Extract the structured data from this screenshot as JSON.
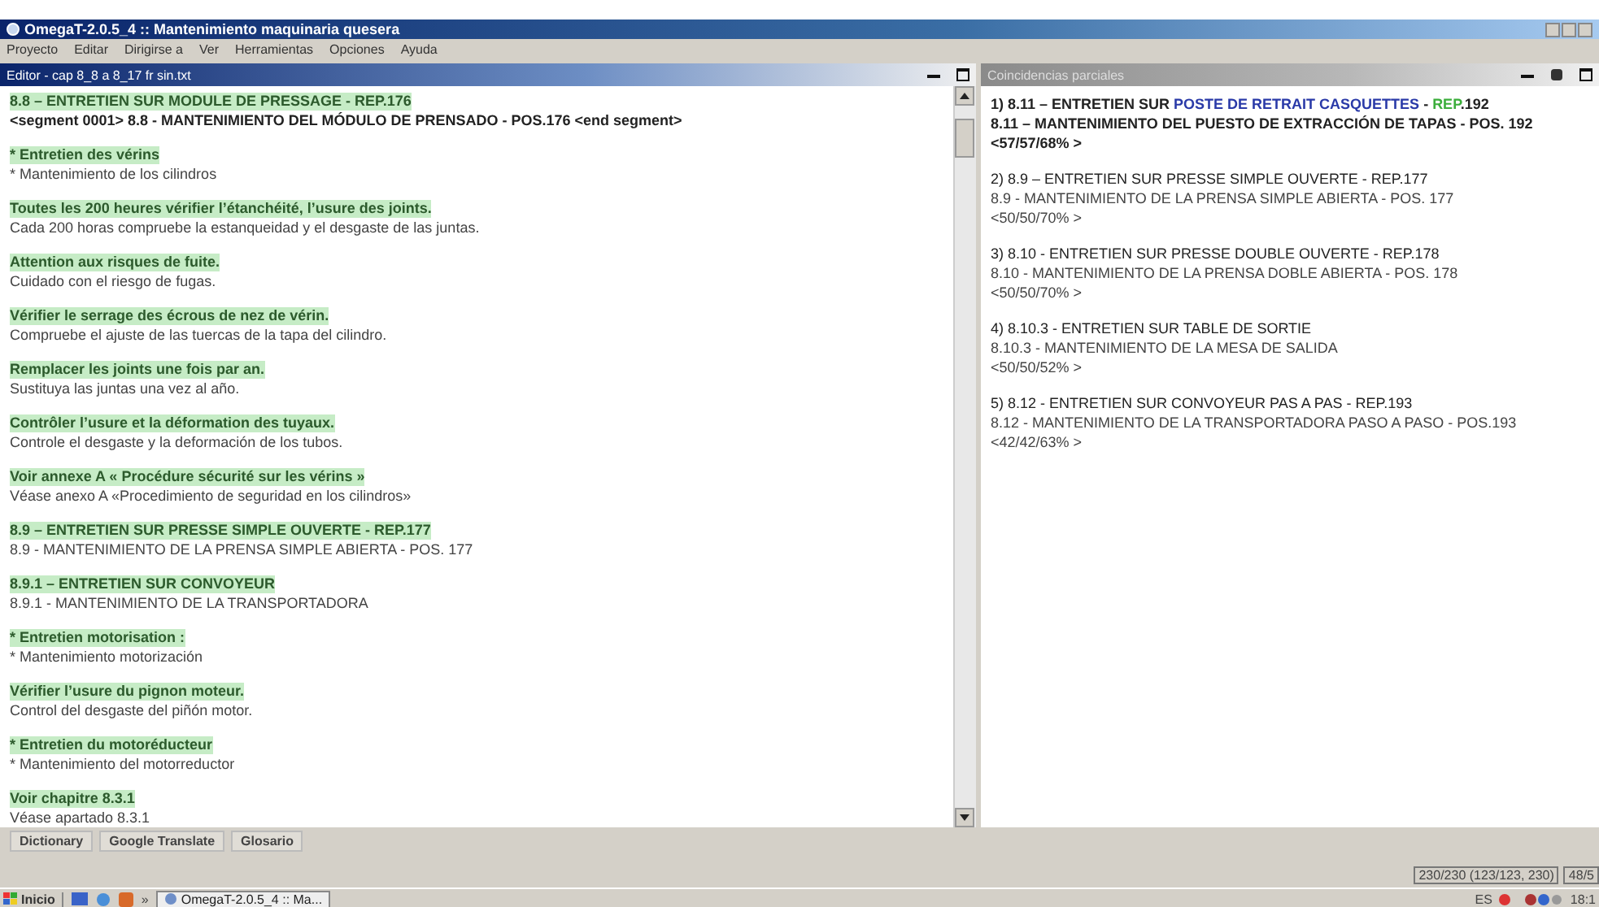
{
  "window": {
    "title": "OmegaT-2.0.5_4 :: Mantenimiento maquinaria quesera"
  },
  "menu": [
    "Proyecto",
    "Editar",
    "Dirigirse a",
    "Ver",
    "Herramientas",
    "Opciones",
    "Ayuda"
  ],
  "editor": {
    "title": "Editor - cap 8_8 a 8_17 fr sin.txt",
    "segments": [
      {
        "source": "8.8 – ENTRETIEN SUR MODULE DE PRESSAGE - REP.176",
        "target": "**<segment 0001>** 8.8 - MANTENIMIENTO DEL MÓDULO DE PRENSADO - POS.176 **<end segment>**",
        "active": true
      },
      {
        "source": "* Entretien des vérins",
        "target": "* Mantenimiento de los cilindros",
        "active": false
      },
      {
        "source": "Toutes les 200 heures  vérifier l’étanchéité, l’usure des joints.",
        "target": "Cada 200 horas compruebe la estanqueidad y el desgaste de las juntas.",
        "active": false
      },
      {
        "source": "Attention aux risques de fuite.",
        "target": "Cuidado con el riesgo de fugas.",
        "active": false
      },
      {
        "source": "Vérifier le serrage des écrous de nez de vérin.",
        "target": "Compruebe el ajuste de las tuercas de la tapa del cilindro.",
        "active": false
      },
      {
        "source": "Remplacer les joints une fois par an.",
        "target": "Sustituya las juntas una vez al año.",
        "active": false
      },
      {
        "source": "Contrôler l’usure et la déformation des tuyaux.",
        "target": "Controle el desgaste y la deformación de los tubos.",
        "active": false
      },
      {
        "source": "Voir annexe A « Procédure sécurité sur les vérins »",
        "target": "Véase anexo A «Procedimiento de seguridad en los cilindros»",
        "active": false
      },
      {
        "source": "8.9 – ENTRETIEN SUR  PRESSE SIMPLE OUVERTE - REP.177",
        "target": "8.9 - MANTENIMIENTO DE LA PRENSA SIMPLE ABIERTA - POS. 177",
        "active": false
      },
      {
        "source": "8.9.1 – ENTRETIEN SUR  CONVOYEUR",
        "target": "8.9.1 - MANTENIMIENTO DE LA TRANSPORTADORA",
        "active": false
      },
      {
        "source": "* Entretien motorisation :",
        "target": "* Mantenimiento motorización",
        "active": false
      },
      {
        "source": "Vérifier l’usure du pignon moteur.",
        "target": "Control del desgaste del piñón motor.",
        "active": false
      },
      {
        "source": "* Entretien du motoréducteur",
        "target": "* Mantenimiento del motorreductor",
        "active": false
      },
      {
        "source": "Voir chapitre 8.3.1",
        "target": "Véase apartado 8.3.1",
        "active": false
      }
    ]
  },
  "matches": {
    "title": "Coincidencias parciales",
    "items": [
      {
        "selected": true,
        "source_parts": [
          {
            "text": "1) 8.11 – ENTRETIEN SUR ",
            "kind": "same"
          },
          {
            "text": "POSTE DE RETRAIT CASQUETTES",
            "kind": "changed"
          },
          {
            "text": " - ",
            "kind": "same"
          },
          {
            "text": "REP",
            "kind": "added"
          },
          {
            "text": ".192",
            "kind": "same"
          }
        ],
        "target": "8.11 – MANTENIMIENTO DEL PUESTO DE EXTRACCIÓN DE TAPAS - POS. 192",
        "score": "<57/57/68% >"
      },
      {
        "selected": false,
        "source_parts": [
          {
            "text": "2) 8.9 – ENTRETIEN SUR  PRESSE SIMPLE OUVERTE - REP.177",
            "kind": "same"
          }
        ],
        "target": "8.9 - MANTENIMIENTO DE LA PRENSA SIMPLE ABIERTA - POS. 177",
        "score": "<50/50/70% >"
      },
      {
        "selected": false,
        "source_parts": [
          {
            "text": "3) 8.10 - ENTRETIEN SUR  PRESSE DOUBLE OUVERTE - REP.178",
            "kind": "same"
          }
        ],
        "target": "8.10 - MANTENIMIENTO DE LA PRENSA DOBLE ABIERTA - POS. 178",
        "score": "<50/50/70% >"
      },
      {
        "selected": false,
        "source_parts": [
          {
            "text": "4) 8.10.3 - ENTRETIEN SUR TABLE DE SORTIE",
            "kind": "same"
          }
        ],
        "target": "8.10.3 - MANTENIMIENTO DE LA MESA DE SALIDA",
        "score": "<50/50/52% >"
      },
      {
        "selected": false,
        "source_parts": [
          {
            "text": "5) 8.12 - ENTRETIEN SUR  CONVOYEUR PAS A PAS - REP.193",
            "kind": "same"
          }
        ],
        "target": "8.12 - MANTENIMIENTO DE LA TRANSPORTADORA PASO A PASO - POS.193",
        "score": "<42/42/63% >"
      }
    ]
  },
  "tabs": [
    {
      "label": "Dictionary",
      "selected": false
    },
    {
      "label": "Google Translate",
      "selected": false
    },
    {
      "label": "Glosario",
      "selected": false
    }
  ],
  "status_bar": [
    "230/230 (123/123, 230)",
    "48/5"
  ],
  "taskbar": {
    "start": "Inicio",
    "overflow": "»",
    "task": "OmegaT-2.0.5_4 :: Ma...",
    "language": "ES",
    "clock": "18:1"
  }
}
